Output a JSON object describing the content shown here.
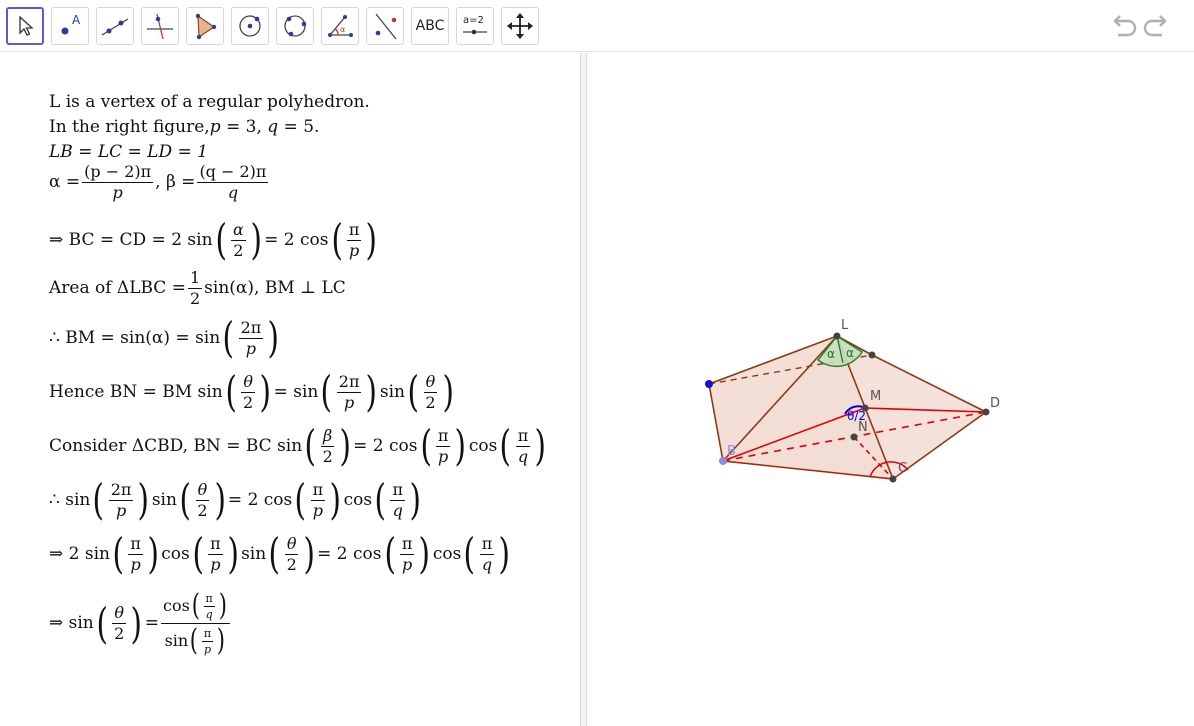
{
  "toolbar": {
    "tools": [
      {
        "name": "move-tool",
        "active": true
      },
      {
        "name": "point-tool",
        "label": "A"
      },
      {
        "name": "line-tool"
      },
      {
        "name": "perpendicular-line-tool"
      },
      {
        "name": "polygon-tool"
      },
      {
        "name": "circle-center-point-tool"
      },
      {
        "name": "circle-through-points-tool"
      },
      {
        "name": "angle-tool",
        "label": "α"
      },
      {
        "name": "reflect-about-line-tool"
      },
      {
        "name": "text-tool",
        "label": "ABC"
      },
      {
        "name": "slider-tool",
        "label": "a=2"
      },
      {
        "name": "move-graphics-view-tool"
      }
    ],
    "undo": "undo-icon",
    "redo": "redo-icon"
  },
  "text": {
    "line1": "L is a vertex of a regular polyhedron.",
    "line2a": "In the right figure,",
    "line2b": "p",
    "line2c": " = 3, ",
    "line2d": "q",
    "line2e": " = 5.",
    "line3": "LB = LC = LD = 1",
    "alpha_lhs": "α =",
    "alpha_num": "(p − 2)π",
    "alpha_den": "p",
    "beta_lhs": ", β =",
    "beta_num": "(q − 2)π",
    "beta_den": "q",
    "bc_lhs": "⇒ BC = CD = 2 sin",
    "bc_frac_num": "α",
    "bc_frac_den": "2",
    "bc_mid": "= 2 cos",
    "bc_frac2_num": "π",
    "bc_frac2_den": "p",
    "area_lhs": "Area of ΔLBC =",
    "area_num": "1",
    "area_den": "2",
    "area_rhs": "sin(α), BM ⊥ LC",
    "bm_lhs": "∴ BM = sin(α) = sin",
    "bm_num": "2π",
    "bm_den": "p",
    "bn_lhs": "Hence BN = BM sin",
    "theta": "θ",
    "two": "2",
    "eq_sin": "= sin",
    "sin": "sin",
    "cos": "cos",
    "consider_lhs": "Consider ΔCBD, BN = BC sin",
    "beta": "β",
    "eq_2cos": "= 2 cos",
    "pi": "π",
    "p": "p",
    "q": "q",
    "twopi": "2π",
    "therefore_sin": "∴ sin",
    "implies_2sin": "⇒ 2 sin",
    "implies_sin": "⇒ sin",
    "eq": "="
  },
  "figure": {
    "labels": {
      "L": "L",
      "M": "M",
      "D": "D",
      "N": "N",
      "B": "B",
      "C": "C",
      "alpha1": "α",
      "alpha2": "α",
      "theta": "θ/2"
    }
  }
}
